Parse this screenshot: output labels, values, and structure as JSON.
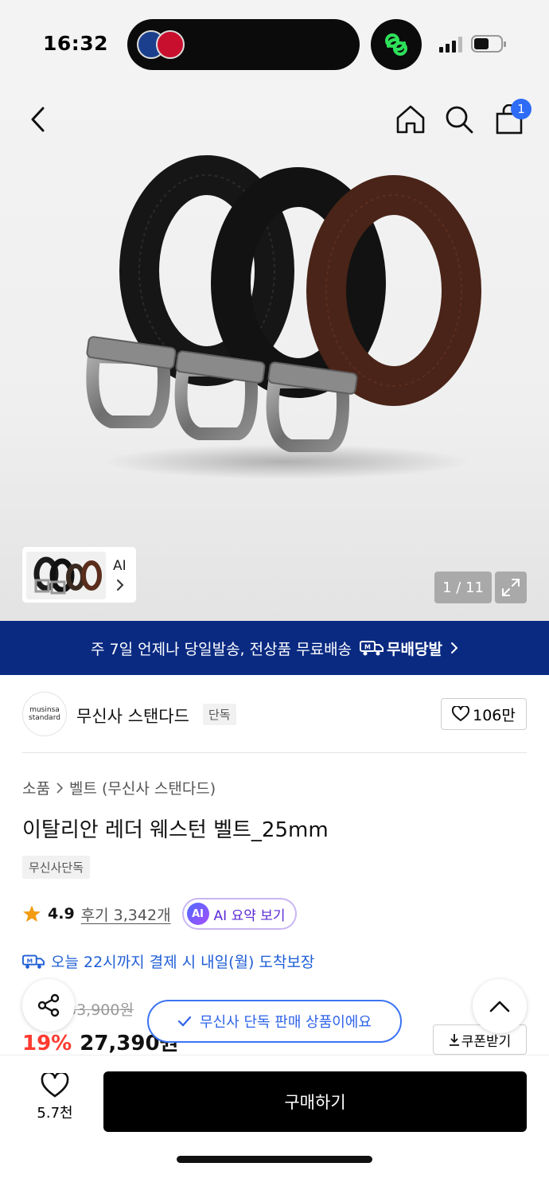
{
  "status_bar": {
    "time": "16:32"
  },
  "nav": {
    "cart_count": "1"
  },
  "gallery": {
    "thumb_label": "AI",
    "counter": "1 / 11"
  },
  "shipping_banner": {
    "text": "주 7일 언제나 당일발송, 전상품 무료배송",
    "tag": "무배당발"
  },
  "brand": {
    "logo_line1": "musinsa",
    "logo_line2": "standard",
    "name": "무신사 스탠다드",
    "tag": "단독",
    "likes": "106만"
  },
  "breadcrumb": {
    "category": "소품",
    "subcategory": "벨트 (무신사 스탠다드)"
  },
  "product": {
    "title": "이탈리안 레더 웨스턴 벨트_25mm",
    "exclusive_tag": "무신사단독",
    "rating": "4.9",
    "reviews": "후기 3,342개",
    "ai_badge": "AI",
    "ai_summary": "AI 요약 보기",
    "delivery": "오늘 22시까지 결제 시 내일(월) 도착보장",
    "original_price": "33,900원",
    "discount": "19%",
    "price": "27,390원",
    "coupon": "쿠폰받기"
  },
  "toast": {
    "text": "무신사 단독 판매 상품이에요"
  },
  "bottom": {
    "wish_count": "5.7천",
    "buy_label": "구매하기"
  },
  "colors": {
    "banner": "#0a2a82",
    "discount": "#ff3b30",
    "link": "#1f5ed6",
    "buy": "#000000"
  }
}
